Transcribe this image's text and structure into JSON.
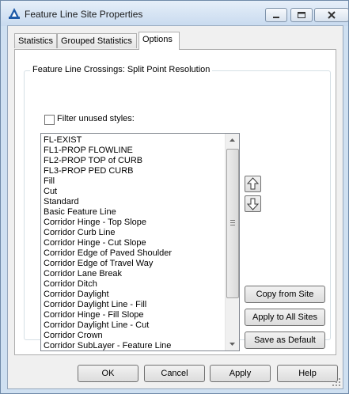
{
  "window": {
    "title": "Feature Line Site Properties"
  },
  "tabs": [
    {
      "label": "Statistics"
    },
    {
      "label": "Grouped Statistics"
    },
    {
      "label": "Options",
      "active": true
    }
  ],
  "options": {
    "group_label": "Feature Line Crossings: Split Point Resolution",
    "filter_checkbox": {
      "label": "Filter unused styles:",
      "checked": false
    },
    "styles": [
      "FL-EXIST",
      "FL1-PROP FLOWLINE",
      "FL2-PROP TOP of CURB",
      "FL3-PROP PED CURB",
      "Fill",
      "Cut",
      "Standard",
      "Basic Feature Line",
      "Corridor Hinge - Top Slope",
      "Corridor Curb Line",
      "Corridor Hinge - Cut Slope",
      "Corridor Edge of Paved Shoulder",
      "Corridor Edge of Travel Way",
      "Corridor Lane Break",
      "Corridor Ditch",
      "Corridor Daylight",
      "Corridor Daylight Line - Fill",
      "Corridor Hinge - Fill Slope",
      "Corridor Daylight Line - Cut",
      "Corridor Crown",
      "Corridor SubLayer - Feature Line"
    ],
    "buttons": {
      "copy_from_site": "Copy from Site",
      "apply_to_all_sites": "Apply to All Sites",
      "save_as_default": "Save as Default"
    }
  },
  "footer": {
    "ok": "OK",
    "cancel": "Cancel",
    "apply": "Apply",
    "help": "Help"
  },
  "colors": {
    "titlebar": "#c8daef",
    "frame": "#cfe0f1",
    "accent": "#1e5aa8"
  }
}
